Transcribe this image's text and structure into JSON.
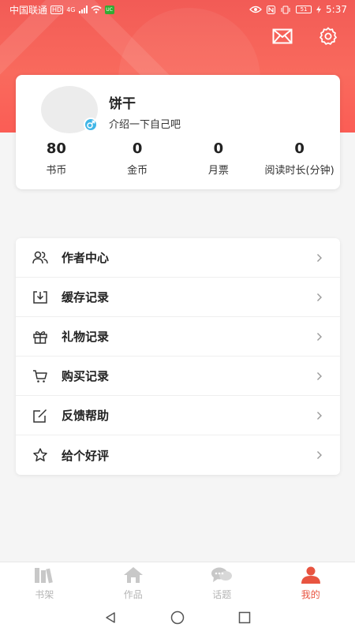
{
  "status_bar": {
    "carrier": "中国联通",
    "hd_badge": "HD",
    "network": "4G",
    "app_badge": "UC",
    "battery": "51",
    "time": "5:37"
  },
  "colors": {
    "accent": "#f25b56",
    "tab_active": "#e85440",
    "gender_badge": "#40b6e7"
  },
  "header": {
    "icons": [
      "mail-icon",
      "settings-icon"
    ]
  },
  "profile": {
    "name": "饼干",
    "bio": "介绍一下自己吧",
    "stats": [
      {
        "value": "80",
        "label": "书币"
      },
      {
        "value": "0",
        "label": "金币"
      },
      {
        "value": "0",
        "label": "月票"
      },
      {
        "value": "0",
        "label": "阅读时长(分钟)"
      }
    ]
  },
  "menu": [
    {
      "label": "作者中心",
      "icon": "users-icon"
    },
    {
      "label": "缓存记录",
      "icon": "download-icon"
    },
    {
      "label": "礼物记录",
      "icon": "gift-icon"
    },
    {
      "label": "购买记录",
      "icon": "cart-icon"
    },
    {
      "label": "反馈帮助",
      "icon": "edit-icon"
    },
    {
      "label": "给个好评",
      "icon": "star-icon"
    }
  ],
  "tabbar": [
    {
      "label": "书架",
      "icon": "bookshelf-icon",
      "active": false
    },
    {
      "label": "作品",
      "icon": "home-icon",
      "active": false
    },
    {
      "label": "话题",
      "icon": "chat-icon",
      "active": false
    },
    {
      "label": "我的",
      "icon": "user-icon",
      "active": true
    }
  ]
}
